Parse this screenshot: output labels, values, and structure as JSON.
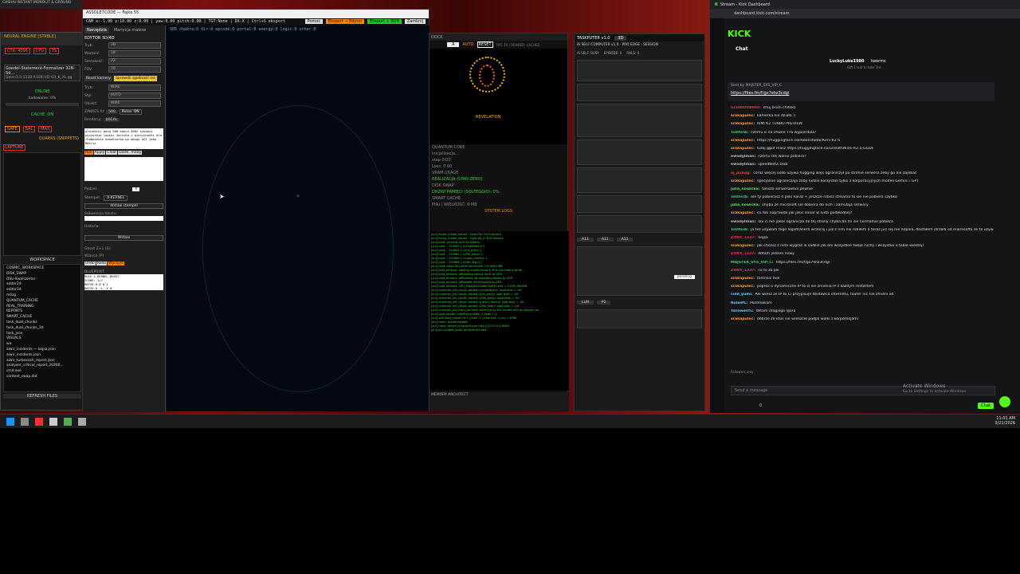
{
  "top_window_title": "ASSOLE7CODE — Fajka 55",
  "left_app": {
    "title": "NEURAL ENGINE [STABLE]",
    "tags": [
      "CTX: 4096",
      "CPU",
      "TS"
    ],
    "model_name": "Goedel-Statement-Formalizer 32B-Sd...",
    "model_sub": "Qwen3.5-122B-A10B-UD-Q3_K_XL.gg",
    "status": "ONLINE",
    "loading": "Ładowanie: 0%",
    "cache": "CACHE: ON",
    "buttons": [
      "SAFE",
      "BAL",
      "MAX"
    ],
    "quarks": "QUARKS (SNIPPETS)",
    "capture": "CAPTURE",
    "workspace_title": "WORKSPACE",
    "tree": [
      "COSMIC_WORKSPACE",
      "DISK_SWAP",
      "DSU-Kwalizontor",
      "editor2d",
      "editor3d",
      "mózg",
      "QUANTUM_CACHE",
      "REAL_TRAINING",
      "REPORTS",
      "SMART_CACHE",
      "task_dual_chunks",
      "task_dual_chunks_3d",
      "task_json",
      "VISUALS",
      "wa",
      "aiwir_incidents — kopia.json",
      "aiwir_incidents.json",
      "aiwir_turbocash_report.json",
      "analyzer_critical_report_20260...",
      "cmd.exe",
      "context_swap.dat"
    ],
    "refresh": "REFRESH FILES"
  },
  "editor": {
    "toolbar_left": "CAM x:-1.00 y:18.00 z:0.00 | yaw:0.00 pitch:0.00 | TGT:None | DX-X | Ctrl+S eksport",
    "toolbar_buttons": [
      "Pomoc",
      "Eksport → Edytor",
      "Eksport + RUN",
      "Zamknij"
    ],
    "side_tabs": [
      "Narzędzia",
      "Mariycja makow"
    ],
    "side_title": "EDYTOR 3D/4D",
    "fields": [
      {
        "label": "Tryb:",
        "value": "3D"
      },
      {
        "label": "Wartość:",
        "value": "18"
      },
      {
        "label": "Szerokość:",
        "value": "22"
      },
      {
        "label": "FOV:",
        "value": "70"
      }
    ],
    "cam_buttons": [
      "Reset kamery",
      "Sprawdź zgodność mz"
    ],
    "selects": [
      {
        "label": "Tryb:",
        "value": "WIRE"
      },
      {
        "label": "Styl:",
        "value": "AUTO"
      },
      {
        "label": "Obiekt:",
        "value": "WIRE"
      }
    ],
    "vertex_label": "ZAKRES XI:",
    "vertex_values": [
      "500",
      "Pulse: ON"
    ],
    "mode_label": "Renderuj:",
    "mode_value": "LOCAL",
    "prompt_text": "projektuj mózg 500 epoch 500t synapsy wszystkie logiki Jarnika i wierzchołki dla rhombiesie konektorów po mózgu AGI jako Matrix",
    "action_buttons": [
      "Run",
      "Apply",
      "Clear",
      "Dziek. mózg"
    ],
    "radius_label": "Pędzel:",
    "radius_value": "X",
    "stamp_label": "Stempel:",
    "stamp_value": "X-KERNEL",
    "insert_stamp": "Wstaw stempel",
    "text_label": "Sekwencja tekstu:",
    "history_label": "Historia:",
    "insert": "Wstaw",
    "ghost": "Ghost Z+1 (G)",
    "pattern": "Wzorce (P)",
    "undo": "Undo",
    "redo": "Redo",
    "clear2": "Wyczyść",
    "blueprint_label": "BLUEPRINT:",
    "blueprint_text": "RULE 1_KERNEL_BOOST\nSCORE: 1+7\nMATCH 0 0 0 1\nMATCH 0 -1 -1 0",
    "hud": "SER  chakra:0  dir:0  epcode:0  portal:0  energy:0  logic:0  other:0"
  },
  "center": {
    "tab_label": "DOCK",
    "sel_value": "A",
    "auto": "AUTO",
    "reset": "RESET",
    "fps": "FPS: 10 | RENDER: CACHED",
    "revelation": "REVELATION",
    "items": [
      "QUANTUM CORE",
      "Inicjalizacja...",
      "step 0/20",
      "Loss: 0.00",
      "VRAM USAGE",
      "REALIZACJA (STAN ZERO)",
      "DISK SWAP",
      "DRZWI PAMIĘCI (SOLFEGGIO): 0%",
      "SMART CACHE",
      "Pliki | WIELKOŚĆ: 0 MB",
      "SYSTEM LOGS"
    ],
    "logs": [
      "[srv] llama_model_loader - type f32: 441 tensors",
      "[srv] llama_model_loader - type q8_0: 400 tensors",
      "[srv] load: printing all EOG tokens:",
      "[srv] load:   - 151643 ('<|endoftext|>')",
      "[srv] load:   - 151645 ('<|im_end|>')",
      "[srv] load:   - 151662 ('<|fim_pad|>')",
      "[srv] load:   - 151663 ('<|repo_name|>')",
      "[srv] load:   - 151664 ('<|file_sep|>')",
      "[srv] load: token to piece cache size = 0.9310 MB",
      "[srv] load_tensors: loading model tensors, this can take a while...",
      "[srv] load_tensors: offloading output layer to GPU",
      "[srv] load_tensors: offloading 48 repeating layers to GPU",
      "[srv] load_tensors: offloaded 49/49 layers to GPU",
      "[srv] load_tensors:   CPU_Mapped model buffer size = 21091.88 MiB",
      "[srv] common_init_result: added <|endoftext|> logit bias = -inf",
      "[srv] common_init_result: added <|im_end|> logit bias = -inf",
      "[srv] common_init_result: added <|fim_pad|> logit bias = -inf",
      "[srv] common_init_result: added <|repo_name|> logit bias = -inf",
      "[srv] common_init_result: added <|file_sep|> logit bias = -inf",
      "[srv] common_init_from_params: warming up the model with an empty run",
      "[srv] load_model: initializing slots, n_slots = 1",
      "[srv] slot   load_model: id 0 | task -1 | new slot, n_ctx = 4096",
      "[srv] main: model loaded",
      "[srv] main: server is listening on http://127.0.0.1:8080",
      "[srv] srv  update_slots: all slots are idle"
    ],
    "footer": "MEMORY ARCHITECT"
  },
  "task": {
    "title": "TASKPUTER v1.0",
    "mode": "3D",
    "subtitle": "AI SELF-COMPUTER v1.0 - PRO EDGE · SESSION",
    "rows": [
      "AI SELF: BUSY",
      "EPISODE: 0",
      "FAILS: 0"
    ],
    "dropdowns": [
      "A11",
      "A11",
      "A11"
    ],
    "status_value": "pending",
    "bottom_selects": [
      "LLM",
      "P2"
    ]
  },
  "kick": {
    "tab_title": "Stream - Kick Dashboard",
    "url": "dashboard.kick.com/stream",
    "logo": "KICK",
    "chat_title": "Chat",
    "top_user": "LuckyLuke1980",
    "top_sub": "Gift 1 sub to take 3rd",
    "top_right": "tworms",
    "pinned_by": "Sent by MAJSTER_SYS_VIP_C",
    "pinned_link": "https://files.fm/f/gx7ehz3cdgl",
    "messages": [
      {
        "user": "SZUBIDUBIDU:",
        "text": "chuj bruni chitsko",
        "color": "#d34"
      },
      {
        "user": "srakapulec:",
        "text": "kamerka nie działa :(",
        "color": "#f93"
      },
      {
        "user": "srakapulec:",
        "text": "KIMI K2 TURBO PREVIEW",
        "color": "#f93"
      },
      {
        "user": "ToOhirA:",
        "text": "czemu ci co chwile TTS wypierdala?",
        "color": "#3c6"
      },
      {
        "user": "srakapulec:",
        "text": "https://huggingface.co/moonshotai/Kimi-K2.5",
        "color": "#f93"
      },
      {
        "user": "srakapulec:",
        "text": "tutaj gguf masz https://huggingface.co/unsloth/Kimi-K2.5-GGUF",
        "color": "#f93"
      },
      {
        "user": "ewodylman:",
        "text": "czemu tak wolno pobiera?",
        "color": "#bbb"
      },
      {
        "user": "ewodylman:",
        "text": "speedtesta zrob",
        "color": "#bbb"
      },
      {
        "user": "aj_pubgg:",
        "text": "coraz więcej osób używa hugging więc ograniczył po stronie serwera żeby go nie zajebać",
        "color": "#e33"
      },
      {
        "user": "srakapulec:",
        "text": "specjalnie ograniczaja zeby ludzie korzystali tylko z korporacyjnych modeli Gemini i GPT",
        "color": "#f93"
      },
      {
        "user": "julia_nowicka:",
        "text": "tansza serwerownia pewnie",
        "color": "#6d6"
      },
      {
        "user": "ToOhirA:",
        "text": "ale ty pobierasz 4 pliki naraz + jeszcze robisz streama to sie nie pobiera szybko",
        "color": "#3c6"
      },
      {
        "user": "julia_nowicka:",
        "text": "chyba ze microsoft sie dobiera do nich i zamulaja serwery",
        "color": "#6d6"
      },
      {
        "user": "srakapulec:",
        "text": "co tak naprawde jak jakis sonar w ludzi podwodnej?",
        "color": "#f93"
      },
      {
        "user": "ewodylman:",
        "text": "oni ci nie jakos ogranicza do tej strony chyba bo mi sie normalnie pobiera",
        "color": "#bbb"
      },
      {
        "user": "ToOhirA:",
        "text": "Ja tez używam tego logistranera wczoraj i już z nim nie robiłem a teraz już się nie odpala, dostałem strzała od mikrosofta że to używam cregości co pokazuje ich klamotka",
        "color": "#3c6"
      },
      {
        "user": "ZONY_1337:",
        "text": "hejka",
        "color": "#d35"
      },
      {
        "user": "srakapulec:",
        "text": "jak chcesz z nimi wygrać w sadzie jak oni wszystkie twoje ruchy i wszystko o tobie wiedzą?",
        "color": "#f93"
      },
      {
        "user": "ZONY_1337:",
        "text": "Witam jestem nowy",
        "color": "#d35"
      },
      {
        "user": "MAJSTER_SYS_VIP_C:",
        "text": "https://files.fm/f/gx7ehz3cdgl",
        "color": "#3c6"
      },
      {
        "user": "ZONY_1337:",
        "text": "co to za pik",
        "color": "#d35"
      },
      {
        "user": "srakapulec:",
        "text": "forensic tool",
        "color": "#f93"
      },
      {
        "user": "srakapulec:",
        "text": "poproc o dynamiczne IP to ci sie zmienia IP z kazdym restartem",
        "color": "#f93"
      },
      {
        "user": "cold_yumi:",
        "text": "Ale wiesz ze IP to Ci przypisuje dostawca internetu, router nic nie zmieni xd",
        "color": "#6cf"
      },
      {
        "user": "RolaiPL:",
        "text": "Pozdrowiam",
        "color": "#6cf"
      },
      {
        "user": "Tocewen%:",
        "text": "Witam drogiego lgora",
        "color": "#6cf"
      },
      {
        "user": "srakapulec:",
        "text": "dobrze ze ktos sie wreszcie podjal walki z korporacjami",
        "color": "#f93"
      }
    ],
    "followers_only": "Followers only",
    "input_placeholder": "Send a message",
    "activate_title": "Activate Windows",
    "activate_sub": "Go to Settings to activate Windows.",
    "chat_button": "Chat",
    "viewer_count": "0"
  },
  "taskbar": {
    "time": "11:01 AM",
    "date": "3/21/2026"
  },
  "colors": {
    "kick_green": "#53fc18",
    "accent_orange": "#ff8c1a",
    "log_green": "#3ad13a"
  }
}
